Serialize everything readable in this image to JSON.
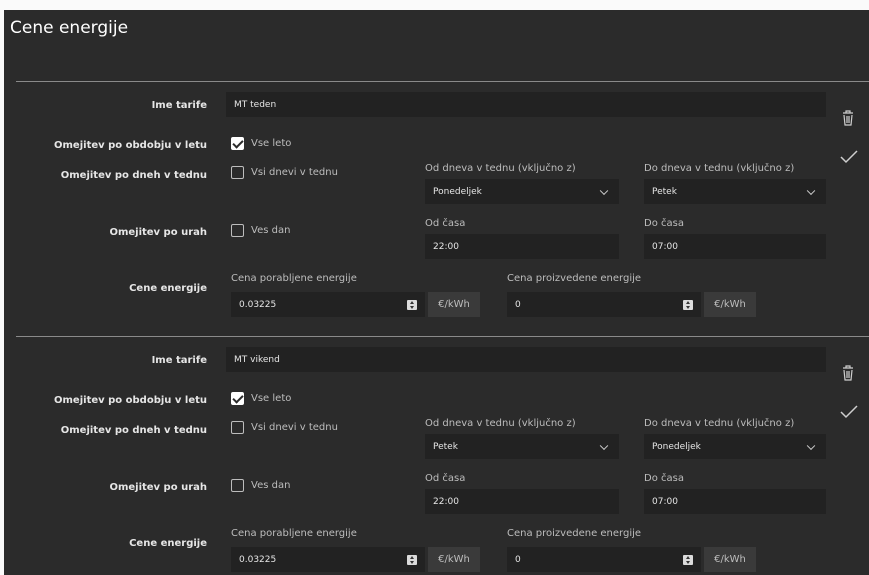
{
  "page": {
    "title": "Cene energije"
  },
  "labels": {
    "tariff_name": "Ime tarife",
    "period_limit": "Omejitev po obdobju v letu",
    "days_limit": "Omejitev po dneh v tednu",
    "hours_limit": "Omejitev po urah",
    "energy_prices": "Cene energije",
    "all_year": "Vse leto",
    "all_week": "Vsi dnevi v tednu",
    "all_day": "Ves dan",
    "from_day": "Od dneva v tednu (vključno z)",
    "to_day": "Do dneva v tednu (vključno z)",
    "from_time": "Od časa",
    "to_time": "Do časa",
    "consumed_price": "Cena porabljene energije",
    "produced_price": "Cena proizvedene energije",
    "unit": "€/kWh"
  },
  "tariffs": [
    {
      "name": "MT teden",
      "all_year_checked": true,
      "all_week_checked": false,
      "from_day": "Ponedeljek",
      "to_day": "Petek",
      "all_day_checked": false,
      "from_time": "22:00",
      "to_time": "07:00",
      "consumed_price": "0.03225",
      "produced_price": "0"
    },
    {
      "name": "MT vikend",
      "all_year_checked": true,
      "all_week_checked": false,
      "from_day": "Petek",
      "to_day": "Ponedeljek",
      "all_day_checked": false,
      "from_time": "22:00",
      "to_time": "07:00",
      "consumed_price": "0.03225",
      "produced_price": "0"
    }
  ],
  "icons": {
    "delete": "trash-icon",
    "confirm": "check-icon"
  }
}
